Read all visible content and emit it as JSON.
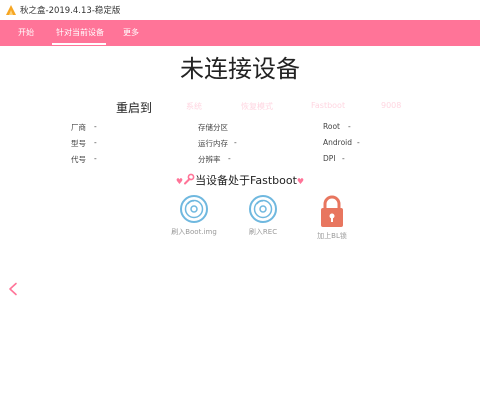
{
  "window": {
    "title": "秋之盒-2019.4.13-稳定版"
  },
  "nav": {
    "items": [
      {
        "label": "开始"
      },
      {
        "label": "针对当前设备"
      },
      {
        "label": "更多"
      }
    ],
    "active_index": 1
  },
  "main": {
    "status_title": "未连接设备",
    "reboot": {
      "label": "重启到",
      "options": [
        "系统",
        "恢复模式",
        "Fastboot",
        "9008"
      ]
    },
    "info_rows": [
      [
        {
          "key": "厂商",
          "value": "-"
        },
        {
          "key": "存储分区",
          "value": ""
        },
        {
          "key": "Root",
          "value": "-"
        }
      ],
      [
        {
          "key": "型号",
          "value": "-"
        },
        {
          "key": "运行内存",
          "value": "-"
        },
        {
          "key": "Android",
          "value": "-"
        }
      ],
      [
        {
          "key": "代号",
          "value": "-"
        },
        {
          "key": "分辨率",
          "value": "-"
        },
        {
          "key": "DPI",
          "value": "-"
        }
      ]
    ],
    "mode": {
      "text": "当设备处于Fastboot",
      "decorations": [
        "heart-icon",
        "wrench-icon",
        "heart-icon"
      ]
    },
    "actions": [
      {
        "label": "刷入Boot.img",
        "icon": "disc-icon"
      },
      {
        "label": "刷入REC",
        "icon": "disc-icon"
      },
      {
        "label": "加上BL锁",
        "icon": "lock-icon"
      }
    ],
    "back_icon": "chevron-left-icon"
  },
  "colors": {
    "accent": "#ff7498",
    "disc_blue": "#6fb8df",
    "lock_red": "#e8765f",
    "faded_pink": "#ffd6e1"
  }
}
